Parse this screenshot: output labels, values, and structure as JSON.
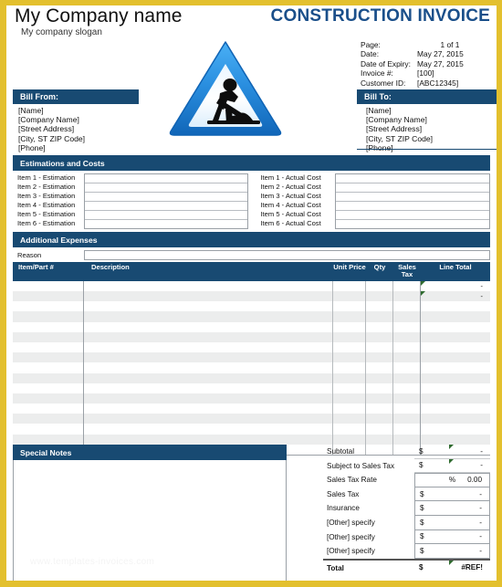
{
  "theme": {
    "border_gold": "#e3c02e",
    "header_blue": "#184a72",
    "title_blue": "#1a4f8a",
    "row_stripe": "#eceded",
    "comment_green": "#2f6b2f"
  },
  "header": {
    "company_name": "My Company name",
    "company_slogan": "My company slogan",
    "doc_title": "CONSTRUCTION INVOICE",
    "meta": [
      {
        "label": "Page:",
        "value": "1 of  1"
      },
      {
        "label": "Date:",
        "value": "May 27, 2015"
      },
      {
        "label": "Date of Expiry:",
        "value": "May 27, 2015"
      },
      {
        "label": "Invoice #:",
        "value": "[100]"
      },
      {
        "label": "Customer ID:",
        "value": "[ABC12345]"
      }
    ]
  },
  "bill_from": {
    "title": "Bill From:",
    "lines": [
      "[Name]",
      "[Company Name]",
      "[Street Address]",
      "[City, ST  ZIP Code]",
      "[Phone]"
    ]
  },
  "bill_to": {
    "title": "Bill To:",
    "lines": [
      "[Name]",
      "[Company Name]",
      "[Street Address]",
      "[City, ST  ZIP Code]",
      "[Phone]"
    ]
  },
  "estimations": {
    "title": "Estimations and Costs",
    "left_labels": [
      "Item 1 - Estimation",
      "Item 2 - Estimation",
      "Item 3 - Estimation",
      "Item 4 - Estimation",
      "Item 5 - Estimation",
      "Item 6 - Estimation"
    ],
    "right_labels": [
      "Item 1 - Actual Cost",
      "Item 2 - Actual Cost",
      "Item 3 - Actual Cost",
      "Item 4 - Actual Cost",
      "Item 5 - Actual Cost",
      "Item 6 - Actual Cost"
    ],
    "left_values": [
      "",
      "",
      "",
      "",
      "",
      ""
    ],
    "right_values": [
      "",
      "",
      "",
      "",
      "",
      ""
    ]
  },
  "additional_expenses": {
    "title": "Additional Expenses",
    "reason_label": "Reason",
    "reason_value": ""
  },
  "items_table": {
    "columns": [
      "Item/Part #",
      "Description",
      "Unit Price",
      "Qty",
      "Sales Tax",
      "Line Total"
    ],
    "rows": [
      {
        "item": "",
        "description": "",
        "unit_price": "",
        "qty": "",
        "sales_tax": "",
        "line_total": "-",
        "comment": true
      },
      {
        "item": "",
        "description": "",
        "unit_price": "",
        "qty": "",
        "sales_tax": "",
        "line_total": "-",
        "comment": true
      },
      {
        "item": "",
        "description": "",
        "unit_price": "",
        "qty": "",
        "sales_tax": "",
        "line_total": "",
        "comment": false
      },
      {
        "item": "",
        "description": "",
        "unit_price": "",
        "qty": "",
        "sales_tax": "",
        "line_total": "",
        "comment": false
      },
      {
        "item": "",
        "description": "",
        "unit_price": "",
        "qty": "",
        "sales_tax": "",
        "line_total": "",
        "comment": false
      },
      {
        "item": "",
        "description": "",
        "unit_price": "",
        "qty": "",
        "sales_tax": "",
        "line_total": "",
        "comment": false
      },
      {
        "item": "",
        "description": "",
        "unit_price": "",
        "qty": "",
        "sales_tax": "",
        "line_total": "",
        "comment": false
      },
      {
        "item": "",
        "description": "",
        "unit_price": "",
        "qty": "",
        "sales_tax": "",
        "line_total": "",
        "comment": false
      },
      {
        "item": "",
        "description": "",
        "unit_price": "",
        "qty": "",
        "sales_tax": "",
        "line_total": "",
        "comment": false
      },
      {
        "item": "",
        "description": "",
        "unit_price": "",
        "qty": "",
        "sales_tax": "",
        "line_total": "",
        "comment": false
      },
      {
        "item": "",
        "description": "",
        "unit_price": "",
        "qty": "",
        "sales_tax": "",
        "line_total": "",
        "comment": false
      },
      {
        "item": "",
        "description": "",
        "unit_price": "",
        "qty": "",
        "sales_tax": "",
        "line_total": "",
        "comment": false
      },
      {
        "item": "",
        "description": "",
        "unit_price": "",
        "qty": "",
        "sales_tax": "",
        "line_total": "",
        "comment": false
      },
      {
        "item": "",
        "description": "",
        "unit_price": "",
        "qty": "",
        "sales_tax": "",
        "line_total": "",
        "comment": false
      },
      {
        "item": "",
        "description": "",
        "unit_price": "",
        "qty": "",
        "sales_tax": "",
        "line_total": "",
        "comment": false
      },
      {
        "item": "",
        "description": "",
        "unit_price": "",
        "qty": "",
        "sales_tax": "",
        "line_total": "",
        "comment": false
      },
      {
        "item": "",
        "description": "",
        "unit_price": "",
        "qty": "",
        "sales_tax": "",
        "line_total": "",
        "comment": false
      }
    ]
  },
  "special_notes": {
    "title": "Special Notes",
    "body": "",
    "watermark": "www.templates-invoices.com"
  },
  "totals": {
    "rows": [
      {
        "label": "Subtotal",
        "currency": "$",
        "amount": "-",
        "boxed": false,
        "comment": true,
        "percent": null
      },
      {
        "label": "Subject to Sales Tax",
        "currency": "$",
        "amount": "-",
        "boxed": false,
        "comment": true,
        "percent": null
      },
      {
        "label": "Sales Tax Rate",
        "currency": "",
        "amount": "0.00",
        "boxed": true,
        "comment": false,
        "percent": "%"
      },
      {
        "label": "Sales Tax",
        "currency": "$",
        "amount": "-",
        "boxed": true,
        "comment": false,
        "percent": null
      },
      {
        "label": "Insurance",
        "currency": "$",
        "amount": "-",
        "boxed": true,
        "comment": false,
        "percent": null
      },
      {
        "label": "[Other] specify",
        "currency": "$",
        "amount": "-",
        "boxed": true,
        "comment": false,
        "percent": null
      },
      {
        "label": "[Other] specify",
        "currency": "$",
        "amount": "-",
        "boxed": true,
        "comment": false,
        "percent": null
      },
      {
        "label": "[Other] specify",
        "currency": "$",
        "amount": "-",
        "boxed": true,
        "comment": false,
        "percent": null
      }
    ],
    "total": {
      "label": "Total",
      "currency": "$",
      "amount": "#REF!",
      "comment": true
    }
  }
}
